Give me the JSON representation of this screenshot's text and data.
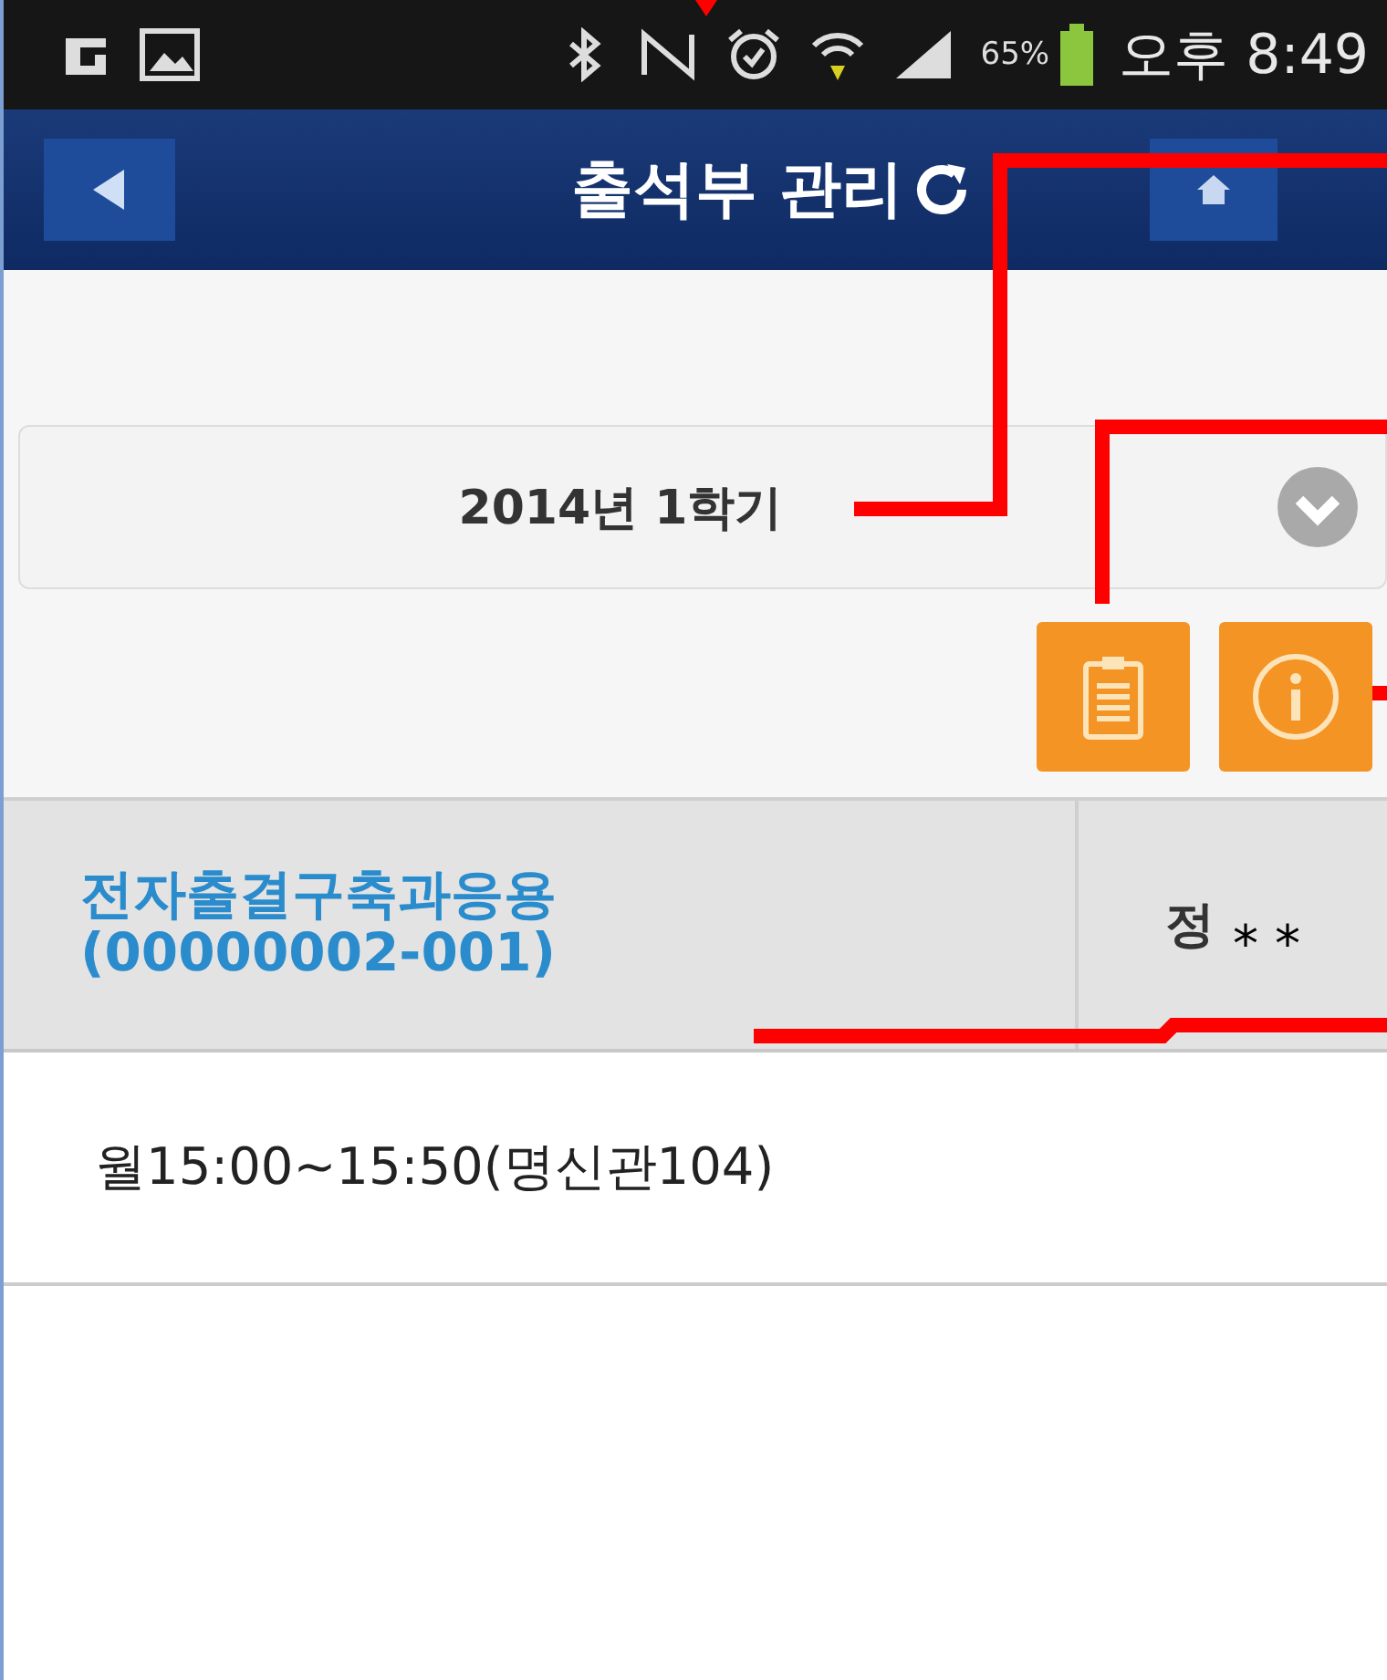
{
  "status_bar": {
    "battery_text": "65%",
    "time": "오후 8:49"
  },
  "header": {
    "title": "출석부 관리"
  },
  "semester_select": {
    "value": "2014년 1학기"
  },
  "table": {
    "header": [
      {
        "kind": "course",
        "lines": [
          "전자출결구축과응용",
          "(00000002-001)"
        ]
      },
      {
        "kind": "name",
        "text": "정",
        "mask": "* *"
      }
    ],
    "rows": [
      {
        "text": "월15:00~15:50(명신관104)"
      }
    ]
  }
}
